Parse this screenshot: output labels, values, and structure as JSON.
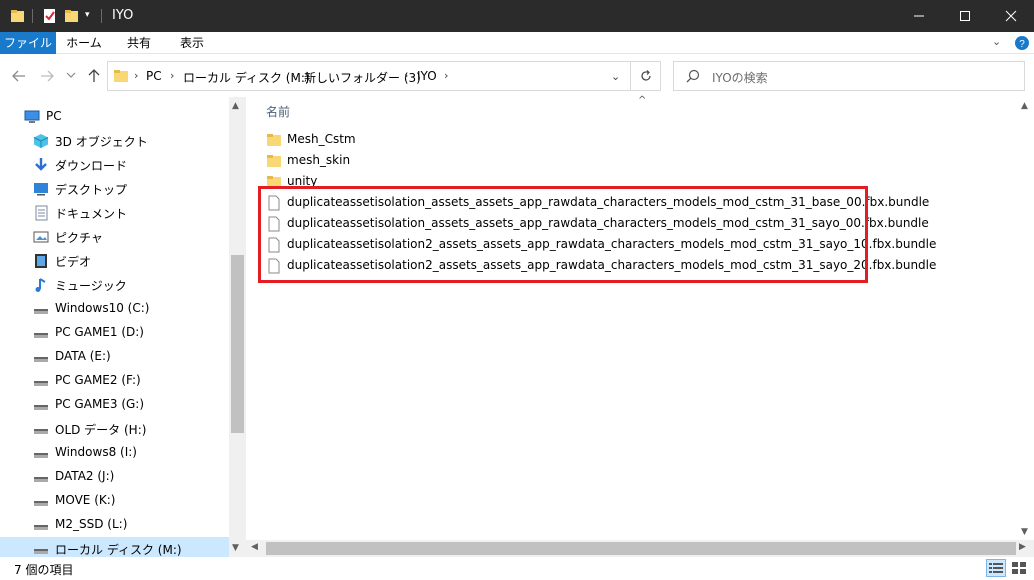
{
  "window": {
    "title": "IYO",
    "controls": {
      "minimize_icon": "minimize-icon",
      "maximize_icon": "maximize-icon",
      "close_icon": "close-icon"
    }
  },
  "ribbon": {
    "tabs": [
      {
        "label": "ファイル",
        "active": true
      },
      {
        "label": "ホーム"
      },
      {
        "label": "共有"
      },
      {
        "label": "表示"
      }
    ]
  },
  "address": {
    "crumbs": [
      "PC",
      "ローカル ディスク (M:)",
      "新しいフォルダー (3)",
      "IYO"
    ],
    "search_placeholder": "IYOの検索"
  },
  "nav": {
    "items": [
      {
        "label": "PC",
        "icon": "pc-icon"
      },
      {
        "label": "3D オブジェクト",
        "icon": "3d-objects-icon"
      },
      {
        "label": "ダウンロード",
        "icon": "download-icon"
      },
      {
        "label": "デスクトップ",
        "icon": "desktop-icon"
      },
      {
        "label": "ドキュメント",
        "icon": "documents-icon"
      },
      {
        "label": "ピクチャ",
        "icon": "pictures-icon"
      },
      {
        "label": "ビデオ",
        "icon": "video-icon"
      },
      {
        "label": "ミュージック",
        "icon": "music-icon"
      },
      {
        "label": "Windows10 (C:)",
        "icon": "drive-icon"
      },
      {
        "label": "PC GAME1 (D:)",
        "icon": "drive-icon"
      },
      {
        "label": "DATA (E:)",
        "icon": "drive-icon"
      },
      {
        "label": "PC GAME2 (F:)",
        "icon": "drive-icon"
      },
      {
        "label": "PC GAME3 (G:)",
        "icon": "drive-icon"
      },
      {
        "label": "OLD データ (H:)",
        "icon": "drive-icon"
      },
      {
        "label": "Windows8 (I:)",
        "icon": "drive-icon"
      },
      {
        "label": "DATA2 (J:)",
        "icon": "drive-icon"
      },
      {
        "label": "MOVE (K:)",
        "icon": "drive-icon"
      },
      {
        "label": "M2_SSD (L:)",
        "icon": "drive-icon"
      },
      {
        "label": "ローカル ディスク (M:)",
        "icon": "drive-icon",
        "selected": true
      }
    ]
  },
  "content": {
    "column_header": "名前",
    "items": [
      {
        "name": "Mesh_Cstm",
        "type": "folder"
      },
      {
        "name": "mesh_skin",
        "type": "folder"
      },
      {
        "name": "unity",
        "type": "folder"
      },
      {
        "name": "duplicateassetisolation_assets_assets_app_rawdata_characters_models_mod_cstm_31_base_00.fbx.bundle",
        "type": "file"
      },
      {
        "name": "duplicateassetisolation_assets_assets_app_rawdata_characters_models_mod_cstm_31_sayo_00.fbx.bundle",
        "type": "file"
      },
      {
        "name": "duplicateassetisolation2_assets_assets_app_rawdata_characters_models_mod_cstm_31_sayo_10.fbx.bundle",
        "type": "file"
      },
      {
        "name": "duplicateassetisolation2_assets_assets_app_rawdata_characters_models_mod_cstm_31_sayo_20.fbx.bundle",
        "type": "file"
      }
    ]
  },
  "status": {
    "item_count": "7 個の項目"
  },
  "colors": {
    "accent": "#1979ca",
    "highlight": "#e31d24",
    "selected": "#cce8ff",
    "folder": "#f8d775"
  }
}
